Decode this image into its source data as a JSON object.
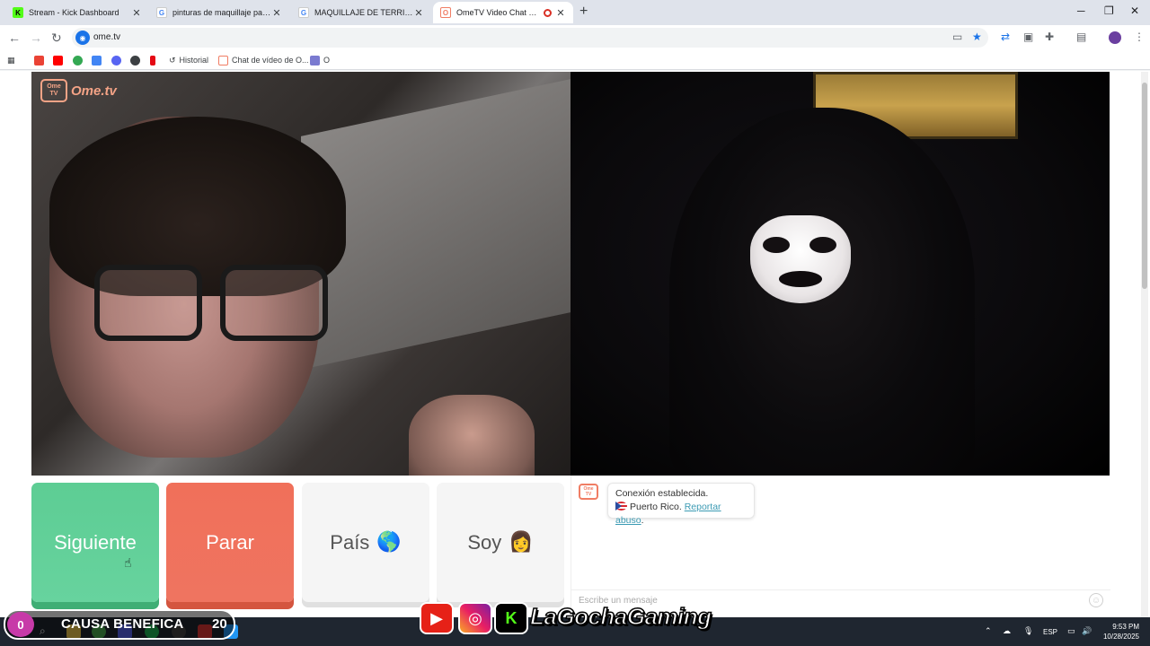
{
  "browser": {
    "tabs": [
      {
        "title": "Stream - Kick Dashboard",
        "favicon": "K",
        "color": "#53fc18"
      },
      {
        "title": "pinturas de maquillaje para hal",
        "favicon": "G",
        "color": "#4285f4"
      },
      {
        "title": "MAQUILLAJE DE TERRIFIER - Bú",
        "favicon": "G",
        "color": "#4285f4"
      },
      {
        "title": "OmeTV Video Chat — Ome",
        "favicon": "O",
        "color": "#f07d64"
      }
    ],
    "url": "ome.tv",
    "bookmarks": [
      {
        "label": "Historial"
      },
      {
        "label": "Chat de vídeo de O..."
      },
      {
        "label": "O"
      }
    ]
  },
  "video": {
    "logo_small": "Ome\nTV",
    "logo_text": "Ome.tv"
  },
  "buttons": {
    "next": "Siguiente",
    "stop": "Parar",
    "country": "País",
    "country_emoji": "🌎",
    "soy": "Soy",
    "soy_emoji": "👩"
  },
  "chat": {
    "logo": "Ome\nTV",
    "status": "Conexión establecida.",
    "country": "Puerto Rico.",
    "report": "Reportar abuso",
    "report_suffix": ".",
    "placeholder": "Escribe un mensaje"
  },
  "overlay": {
    "counter": "0",
    "cause": "CAUSA BENEFICA",
    "goal": "20",
    "youtube": "▶",
    "instagram": "◎",
    "kick": "K",
    "handle": "LaGochaGaming"
  },
  "taskbar": {
    "lang": "ESP",
    "time": "9:53 PM",
    "date": "10/28/2025"
  },
  "colors": {
    "next": "#5dcd94",
    "stop": "#f0705a",
    "ome_accent": "#f07d64"
  }
}
